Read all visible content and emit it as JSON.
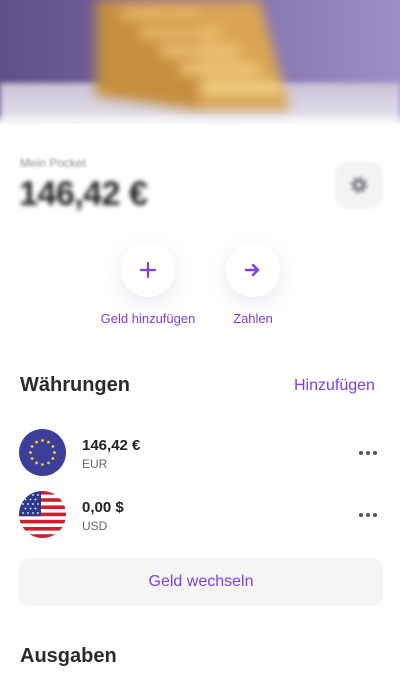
{
  "pocket": {
    "label": "Mein Pocket",
    "balance": "146,42 €"
  },
  "actions": [
    {
      "icon": "plus-icon",
      "label": "Geld hinzufügen"
    },
    {
      "icon": "arrow-right-icon",
      "label": "Zahlen"
    }
  ],
  "currencies": {
    "title": "Währungen",
    "add_label": "Hinzufügen",
    "items": [
      {
        "amount": "146,42 €",
        "code": "EUR",
        "flag": "eu-flag-icon"
      },
      {
        "amount": "0,00 $",
        "code": "USD",
        "flag": "us-flag-icon"
      }
    ],
    "exchange_label": "Geld wechseln"
  },
  "spending": {
    "title": "Ausgaben"
  },
  "colors": {
    "accent": "#7b3fe4",
    "eu_blue": "#3b3f9a",
    "us_red": "#c8202f"
  }
}
